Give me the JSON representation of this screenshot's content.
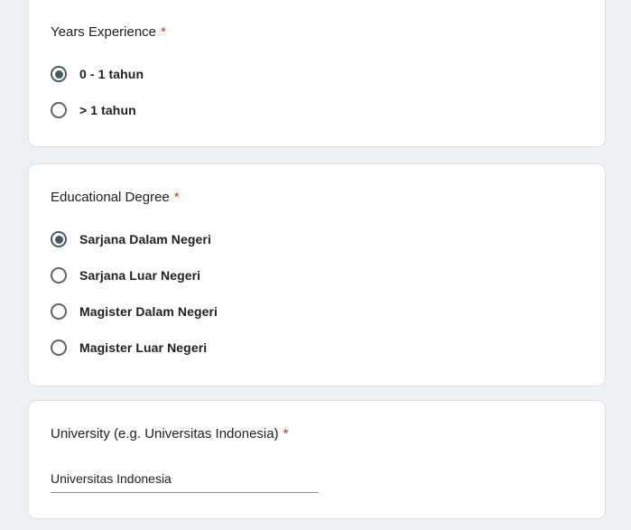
{
  "page": {
    "background_color": "#eff0f2",
    "card_background": "#ffffff",
    "card_border_color": "#dde0e3"
  },
  "colors": {
    "accent_radio_selected": "#465a64",
    "radio_unselected_border": "#5f6368",
    "required_asterisk": "#d93025",
    "text_primary": "#202124",
    "input_underline": "#8f9499"
  },
  "questions": [
    {
      "title": "Years Experience",
      "required_marker": "*",
      "type": "radio",
      "options": [
        {
          "label": "0 - 1 tahun",
          "selected": true
        },
        {
          "label": "> 1 tahun",
          "selected": false
        }
      ]
    },
    {
      "title": "Educational Degree",
      "required_marker": "*",
      "type": "radio",
      "options": [
        {
          "label": "Sarjana Dalam Negeri",
          "selected": true
        },
        {
          "label": "Sarjana Luar Negeri",
          "selected": false
        },
        {
          "label": "Magister Dalam Negeri",
          "selected": false
        },
        {
          "label": "Magister Luar Negeri",
          "selected": false
        }
      ]
    },
    {
      "title": "University (e.g. Universitas Indonesia)",
      "required_marker": "*",
      "type": "text",
      "value": "Universitas Indonesia"
    }
  ]
}
